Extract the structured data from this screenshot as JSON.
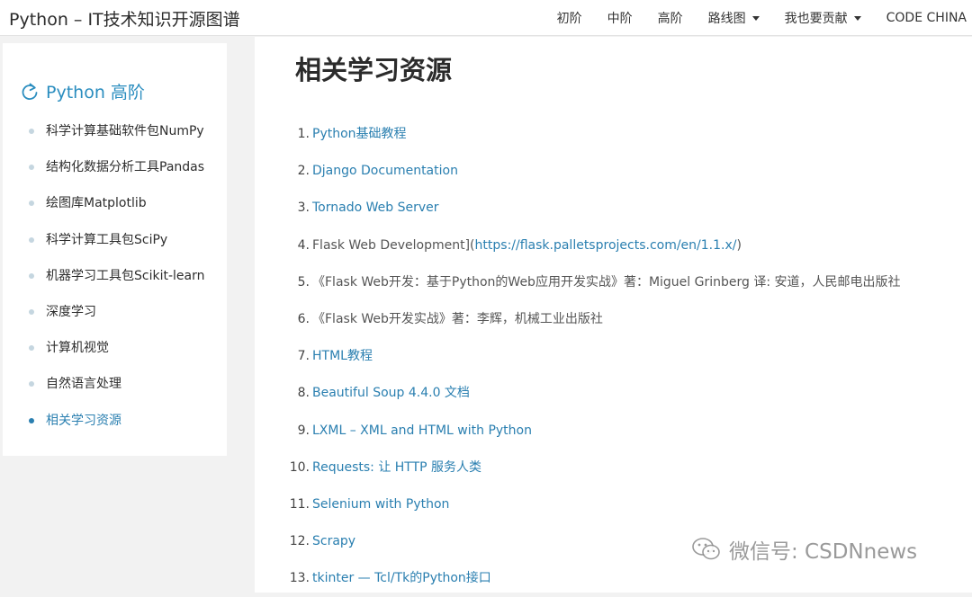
{
  "header": {
    "brand": "Python – IT技术知识开源图谱",
    "nav": [
      {
        "label": "初阶",
        "dropdown": false
      },
      {
        "label": "中阶",
        "dropdown": false
      },
      {
        "label": "高阶",
        "dropdown": false
      },
      {
        "label": "路线图",
        "dropdown": true
      },
      {
        "label": "我也要贡献",
        "dropdown": true
      },
      {
        "label": "CODE CHINA",
        "dropdown": false
      }
    ]
  },
  "sidebar": {
    "title": "Python 高阶",
    "items": [
      {
        "label": "科学计算基础软件包NumPy",
        "active": false
      },
      {
        "label": "结构化数据分析工具Pandas",
        "active": false
      },
      {
        "label": "绘图库Matplotlib",
        "active": false
      },
      {
        "label": "科学计算工具包SciPy",
        "active": false
      },
      {
        "label": "机器学习工具包Scikit-learn",
        "active": false
      },
      {
        "label": "深度学习",
        "active": false
      },
      {
        "label": "计算机视觉",
        "active": false
      },
      {
        "label": "自然语言处理",
        "active": false
      },
      {
        "label": "相关学习资源",
        "active": true
      }
    ]
  },
  "main": {
    "title": "相关学习资源",
    "references": [
      {
        "num": "1.",
        "parts": [
          {
            "text": "Python基础教程",
            "link": true
          }
        ]
      },
      {
        "num": "2.",
        "parts": [
          {
            "text": "Django Documentation",
            "link": true
          }
        ]
      },
      {
        "num": "3.",
        "parts": [
          {
            "text": "Tornado Web Server",
            "link": true
          }
        ]
      },
      {
        "num": "4.",
        "parts": [
          {
            "text": "Flask Web Development](",
            "link": false
          },
          {
            "text": "https://flask.palletsprojects.com/en/1.1.x/",
            "link": true
          },
          {
            "text": ")",
            "link": false
          }
        ]
      },
      {
        "num": "5.",
        "parts": [
          {
            "text": "《Flask Web开发：基于Python的Web应用开发实战》著：Miguel Grinberg 译: 安道，人民邮电出版社",
            "link": false
          }
        ]
      },
      {
        "num": "6.",
        "parts": [
          {
            "text": "《Flask Web开发实战》著：李辉，机械工业出版社",
            "link": false
          }
        ]
      },
      {
        "num": "7.",
        "parts": [
          {
            "text": "HTML教程",
            "link": true
          }
        ]
      },
      {
        "num": "8.",
        "parts": [
          {
            "text": "Beautiful Soup 4.4.0 文档",
            "link": true
          }
        ]
      },
      {
        "num": "9.",
        "parts": [
          {
            "text": "LXML – XML and HTML with Python",
            "link": true
          }
        ]
      },
      {
        "num": "10.",
        "parts": [
          {
            "text": "Requests: 让 HTTP 服务人类",
            "link": true
          }
        ]
      },
      {
        "num": "11.",
        "parts": [
          {
            "text": "Selenium with Python",
            "link": true
          }
        ]
      },
      {
        "num": "12.",
        "parts": [
          {
            "text": "Scrapy",
            "link": true
          }
        ]
      },
      {
        "num": "13.",
        "parts": [
          {
            "text": "tkinter — Tcl/Tk的Python接口",
            "link": true
          }
        ]
      }
    ]
  },
  "watermark": {
    "text": "微信号: CSDNnews",
    "icon": "wechat-icon"
  },
  "colors": {
    "link": "#2a7fb0",
    "accent": "#2a8dbf",
    "sidebar_dot": "#c5d6e0"
  }
}
